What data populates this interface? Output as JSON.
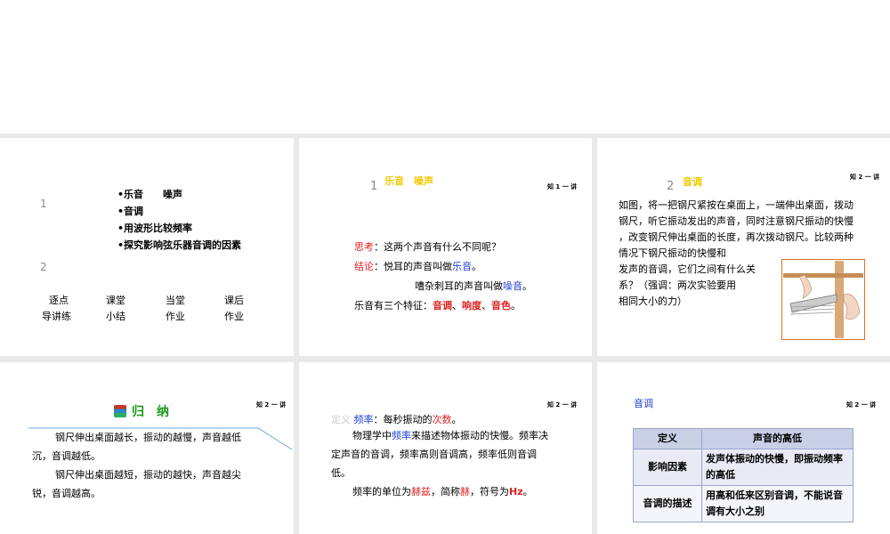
{
  "slide1": {
    "num1": "1",
    "num2": "2",
    "bullets": [
      "•乐音　　噪声",
      "•音调",
      "•用波形比较频率",
      "•探究影响弦乐器音调的因素"
    ],
    "nav": [
      {
        "l1": "逐点",
        "l2": "导讲练"
      },
      {
        "l1": "课堂",
        "l2": "小结"
      },
      {
        "l1": "当堂",
        "l2": "作业"
      },
      {
        "l1": "课后",
        "l2": "作业"
      }
    ]
  },
  "slide2": {
    "num": "1",
    "title": "乐音　噪声",
    "tag": "知 1 一 讲",
    "think_label": "思考",
    "think_text": "：这两个声音有什么不同呢？",
    "concl_label": "结论",
    "concl_text": "：悦耳的声音叫做",
    "concl_word": "乐音",
    "concl_end": "。",
    "noise_text": "嘈杂刺耳的声音叫做",
    "noise_word": "噪音",
    "noise_end": "。",
    "feat_text": "乐音有三个特征：",
    "feat1": "音调",
    "sep1": "、",
    "feat2": "响度",
    "sep2": "、",
    "feat3": "音色",
    "feat_end": "。"
  },
  "slide3": {
    "num": "2",
    "title": "音调",
    "tag": "知 2 一 讲",
    "lines": [
      "如图，将一把钢尺紧按在桌面上，一端伸出桌面，拨动",
      "钢尺，听它振动发出的声音，同时注意钢尺振动的快慢",
      "，改变钢尺伸出桌面的长度，再次拨动钢尺。比较两种",
      "情况下钢尺振动的快慢和",
      "发声的音调，它们之间有什么关",
      "系？（强调：两次实验要用",
      "相同大小的力）"
    ]
  },
  "slide4": {
    "tag": "知 2 一 讲",
    "title": "归　纳",
    "lines": [
      "钢尺伸出桌面越长，振动的越慢，声音越低",
      "沉，音调越低。",
      "钢尺伸出桌面越短，振动的越快，声音越尖",
      "锐，音调越高。"
    ]
  },
  "slide5": {
    "tag": "知 2 一 讲",
    "def_label": "定义",
    "def_word": "频率",
    "def_text": "：每秒振动的",
    "def_word2": "次数",
    "def_end": "。",
    "p1a": "物理学中",
    "p1b": "频率",
    "p1c": "来描述物体振动的快慢。频率决",
    "p1d": "定声音的音调，频率高则音调高，频率低则音调",
    "p1e": "低。",
    "p2a": "频率的单位为",
    "p2b": "赫兹",
    "p2c": "，简称",
    "p2d": "赫",
    "p2e": "，符号为",
    "p2f": "Hz",
    "p2g": "。"
  },
  "slide6": {
    "tag": "知 2 一 讲",
    "title": "音调",
    "rows": [
      {
        "k": "定义",
        "v": "声音的高低"
      },
      {
        "k": "影响因素",
        "v": "发声体振动的快慢，即振动频率的高低"
      },
      {
        "k": "音调的描述",
        "v": "用高和低来区别音调，不能说音调有大小之别"
      }
    ]
  }
}
